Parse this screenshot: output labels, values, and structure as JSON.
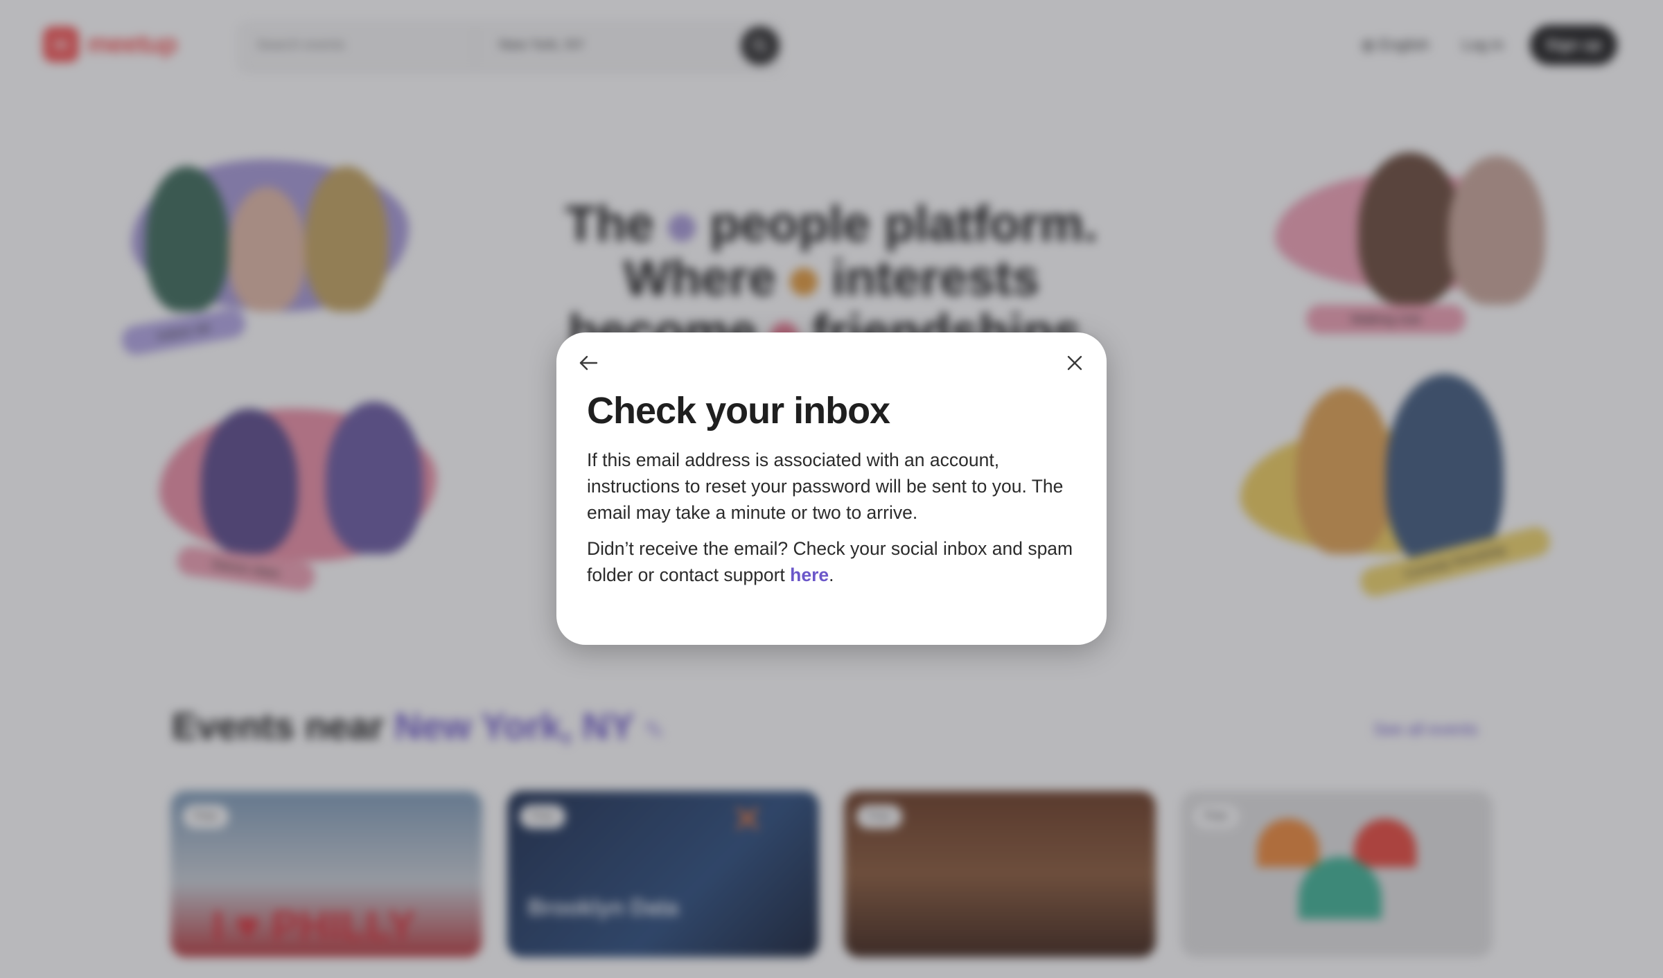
{
  "header": {
    "logo_text": "meetup",
    "search_placeholder": "Search events",
    "location_value": "New York, NY",
    "language_label": "English",
    "login_label": "Log in",
    "signup_label": "Sign up"
  },
  "hero": {
    "line1_a": "The",
    "line1_b": "people platform.",
    "line2_a": "Where",
    "line2_b": "interests",
    "line3_a": "become",
    "line3_b": "friendships.",
    "tags": [
      "Indoor ski",
      "Dance class",
      "Walking club",
      "Comedy friendship"
    ]
  },
  "events": {
    "heading": "Events near",
    "city": "New York, NY",
    "see_all": "See all events",
    "cards": [
      {
        "badge": "Free",
        "text": "I ♥ PHILLY"
      },
      {
        "badge": "Free",
        "text": "Brooklyn Data"
      },
      {
        "badge": "Free",
        "text": ""
      },
      {
        "badge": "Free",
        "text": ""
      }
    ]
  },
  "modal": {
    "title": "Check your inbox",
    "paragraph1": "If this email address is associated with an account, instructions to reset your password will be sent to you. The email may take a minute or two to arrive.",
    "paragraph2_text": "Didn’t receive the email? Check your social inbox and spam folder or contact support ",
    "paragraph2_link": "here",
    "paragraph2_end": "."
  },
  "colors": {
    "brand": "#f65858",
    "accent_link": "#6b57c9",
    "overlay": "rgba(58,58,66,0.36)"
  },
  "icons": {
    "back": "arrow-left-icon",
    "close": "close-icon",
    "search": "search-icon",
    "globe": "globe-icon"
  }
}
